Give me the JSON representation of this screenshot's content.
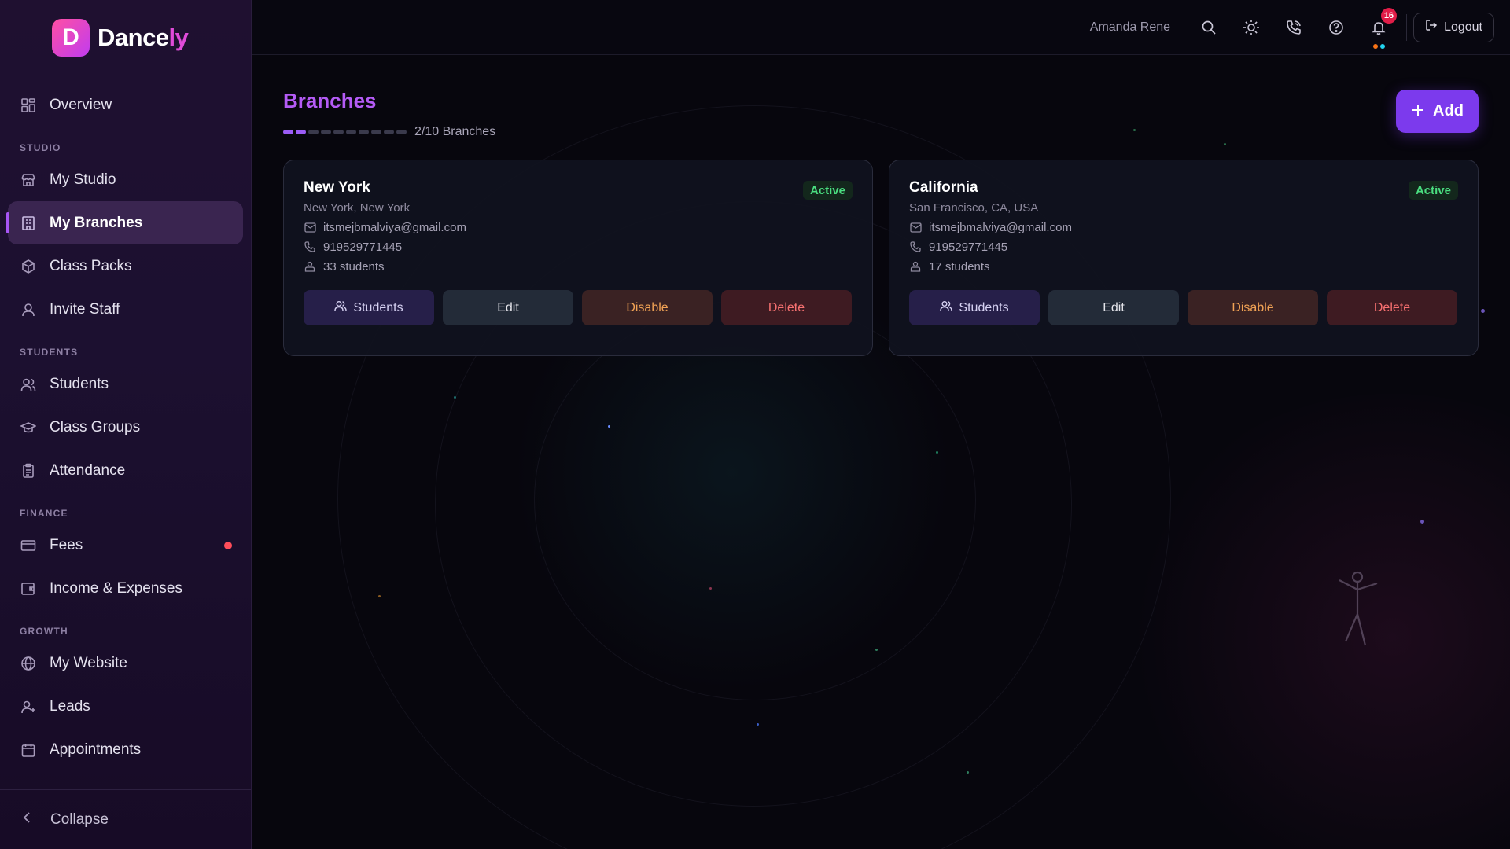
{
  "brand": {
    "logo_letter": "D",
    "name_main": "Dance",
    "name_accent": "ly"
  },
  "sidebar": {
    "items": [
      {
        "label": "Overview",
        "icon": "grid-icon"
      },
      {
        "section": "STUDIO"
      },
      {
        "label": "My Studio",
        "icon": "store-icon"
      },
      {
        "label": "My Branches",
        "icon": "building-icon",
        "active": true
      },
      {
        "label": "Class Packs",
        "icon": "package-icon"
      },
      {
        "label": "Invite Staff",
        "icon": "user-icon"
      },
      {
        "section": "STUDENTS"
      },
      {
        "label": "Students",
        "icon": "users-icon"
      },
      {
        "label": "Class Groups",
        "icon": "graduation-cap-icon"
      },
      {
        "label": "Attendance",
        "icon": "clipboard-icon"
      },
      {
        "section": "FINANCE"
      },
      {
        "label": "Fees",
        "icon": "credit-card-icon",
        "dot": true
      },
      {
        "label": "Income & Expenses",
        "icon": "wallet-icon"
      },
      {
        "section": "GROWTH"
      },
      {
        "label": "My Website",
        "icon": "globe-icon"
      },
      {
        "label": "Leads",
        "icon": "user-plus-icon"
      },
      {
        "label": "Appointments",
        "icon": "calendar-icon"
      }
    ],
    "collapse_label": "Collapse"
  },
  "header": {
    "user_name": "Amanda Rene",
    "notification_count": "16",
    "logout_label": "Logout"
  },
  "main": {
    "title": "Branches",
    "progress": {
      "used": 2,
      "total": 10,
      "label": "2/10 Branches"
    },
    "add_label": "Add",
    "branches": [
      {
        "name": "New York",
        "location": "New York, New York",
        "status": "Active",
        "email": "itsmejbmalviya@gmail.com",
        "phone": "919529771445",
        "students": "33 students"
      },
      {
        "name": "California",
        "location": "San Francisco, CA, USA",
        "status": "Active",
        "email": "itsmejbmalviya@gmail.com",
        "phone": "919529771445",
        "students": "17 students"
      }
    ],
    "actions": {
      "students": "Students",
      "edit": "Edit",
      "disable": "Disable",
      "delete": "Delete"
    }
  },
  "colors": {
    "accent": "#7c3aed",
    "title": "#b45bf5",
    "active": "#4ade80",
    "disable": "#f2a355",
    "delete": "#f87171",
    "badge": "#e11d48"
  }
}
